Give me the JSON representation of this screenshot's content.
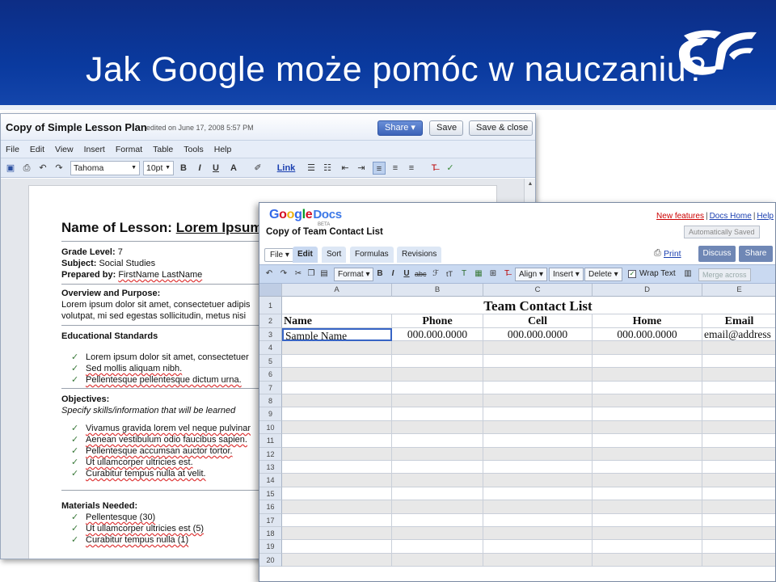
{
  "slide": {
    "title": "Jak Google może pomóc w nauczaniu?"
  },
  "doc": {
    "name": "Copy of Simple Lesson Plan",
    "edited": "edited on June 17, 2008 5:57 PM",
    "buttons": {
      "share": "Share ▾",
      "save": "Save",
      "save_close": "Save & close"
    },
    "menu": [
      "File",
      "Edit",
      "View",
      "Insert",
      "Format",
      "Table",
      "Tools",
      "Help"
    ],
    "toolbar": {
      "font": "Tahoma",
      "size": "10pt",
      "link": "Link"
    },
    "content": {
      "title_label": "Name of Lesson:",
      "title_value": "Lorem Ipsum",
      "grade_label": "Grade Level:",
      "grade_value": "7",
      "subject_label": "Subject:",
      "subject_value": "Social Studies",
      "prepared_label": "Prepared by:",
      "prepared_value": "FirstName LastName",
      "overview_heading": "Overview and Purpose:",
      "overview_line1": "Lorem ipsum dolor sit amet, consectetuer adipis",
      "overview_line2": "volutpat, mi sed egestas sollicitudin, metus nisi",
      "standards_heading": "Educational Standards",
      "standards": [
        "Lorem ipsum dolor sit amet, consectetuer",
        "Sed mollis aliquam nibh.",
        "Pellentesque pellentesque dictum urna."
      ],
      "objectives_heading": "Objectives:",
      "objectives_sub": "Specify skills/information that will be learned",
      "objectives": [
        "Vivamus gravida lorem vel neque pulvinar",
        "Aenean vestibulum odio faucibus sapien.",
        "Pellentesque accumsan auctor tortor.",
        "Ut ullamcorper ultricies est.",
        "Curabitur tempus nulla at velit."
      ],
      "materials_heading": "Materials Needed:",
      "materials": [
        "Pellentesque (30)",
        "Ut ullamcorper ultricies est (5)",
        "Curabitur tempus nulla (1)"
      ]
    }
  },
  "sheet": {
    "logo_google": "Google",
    "logo_docs": "Docs",
    "logo_beta": "BETA",
    "links": {
      "new_features": "New features",
      "docs_home": "Docs Home",
      "help": "Help"
    },
    "name": "Copy of Team Contact List",
    "autosave": "Automatically Saved",
    "tabs": {
      "file": "File ▾",
      "edit": "Edit",
      "sort": "Sort",
      "formulas": "Formulas",
      "revisions": "Revisions"
    },
    "print": "Print",
    "discuss": "Discuss",
    "share": "Share",
    "toolbar": {
      "format": "Format ▾",
      "align": "Align ▾",
      "insert": "Insert ▾",
      "delete": "Delete ▾",
      "wrap": "Wrap Text",
      "merge": "Merge across"
    },
    "columns": [
      "A",
      "B",
      "C",
      "D",
      "E"
    ],
    "rows": [
      "1",
      "2",
      "3",
      "4",
      "5",
      "6",
      "7",
      "8",
      "9",
      "10",
      "11",
      "12",
      "13",
      "14",
      "15",
      "16",
      "17",
      "18",
      "19",
      "20"
    ],
    "title": "Team Contact List",
    "headers": [
      "Name",
      "Phone",
      "Cell",
      "Home",
      "Email"
    ],
    "data_row": [
      "Sample Name",
      "000.000.0000",
      "000.000.0000",
      "000.000.0000",
      "email@address"
    ]
  }
}
